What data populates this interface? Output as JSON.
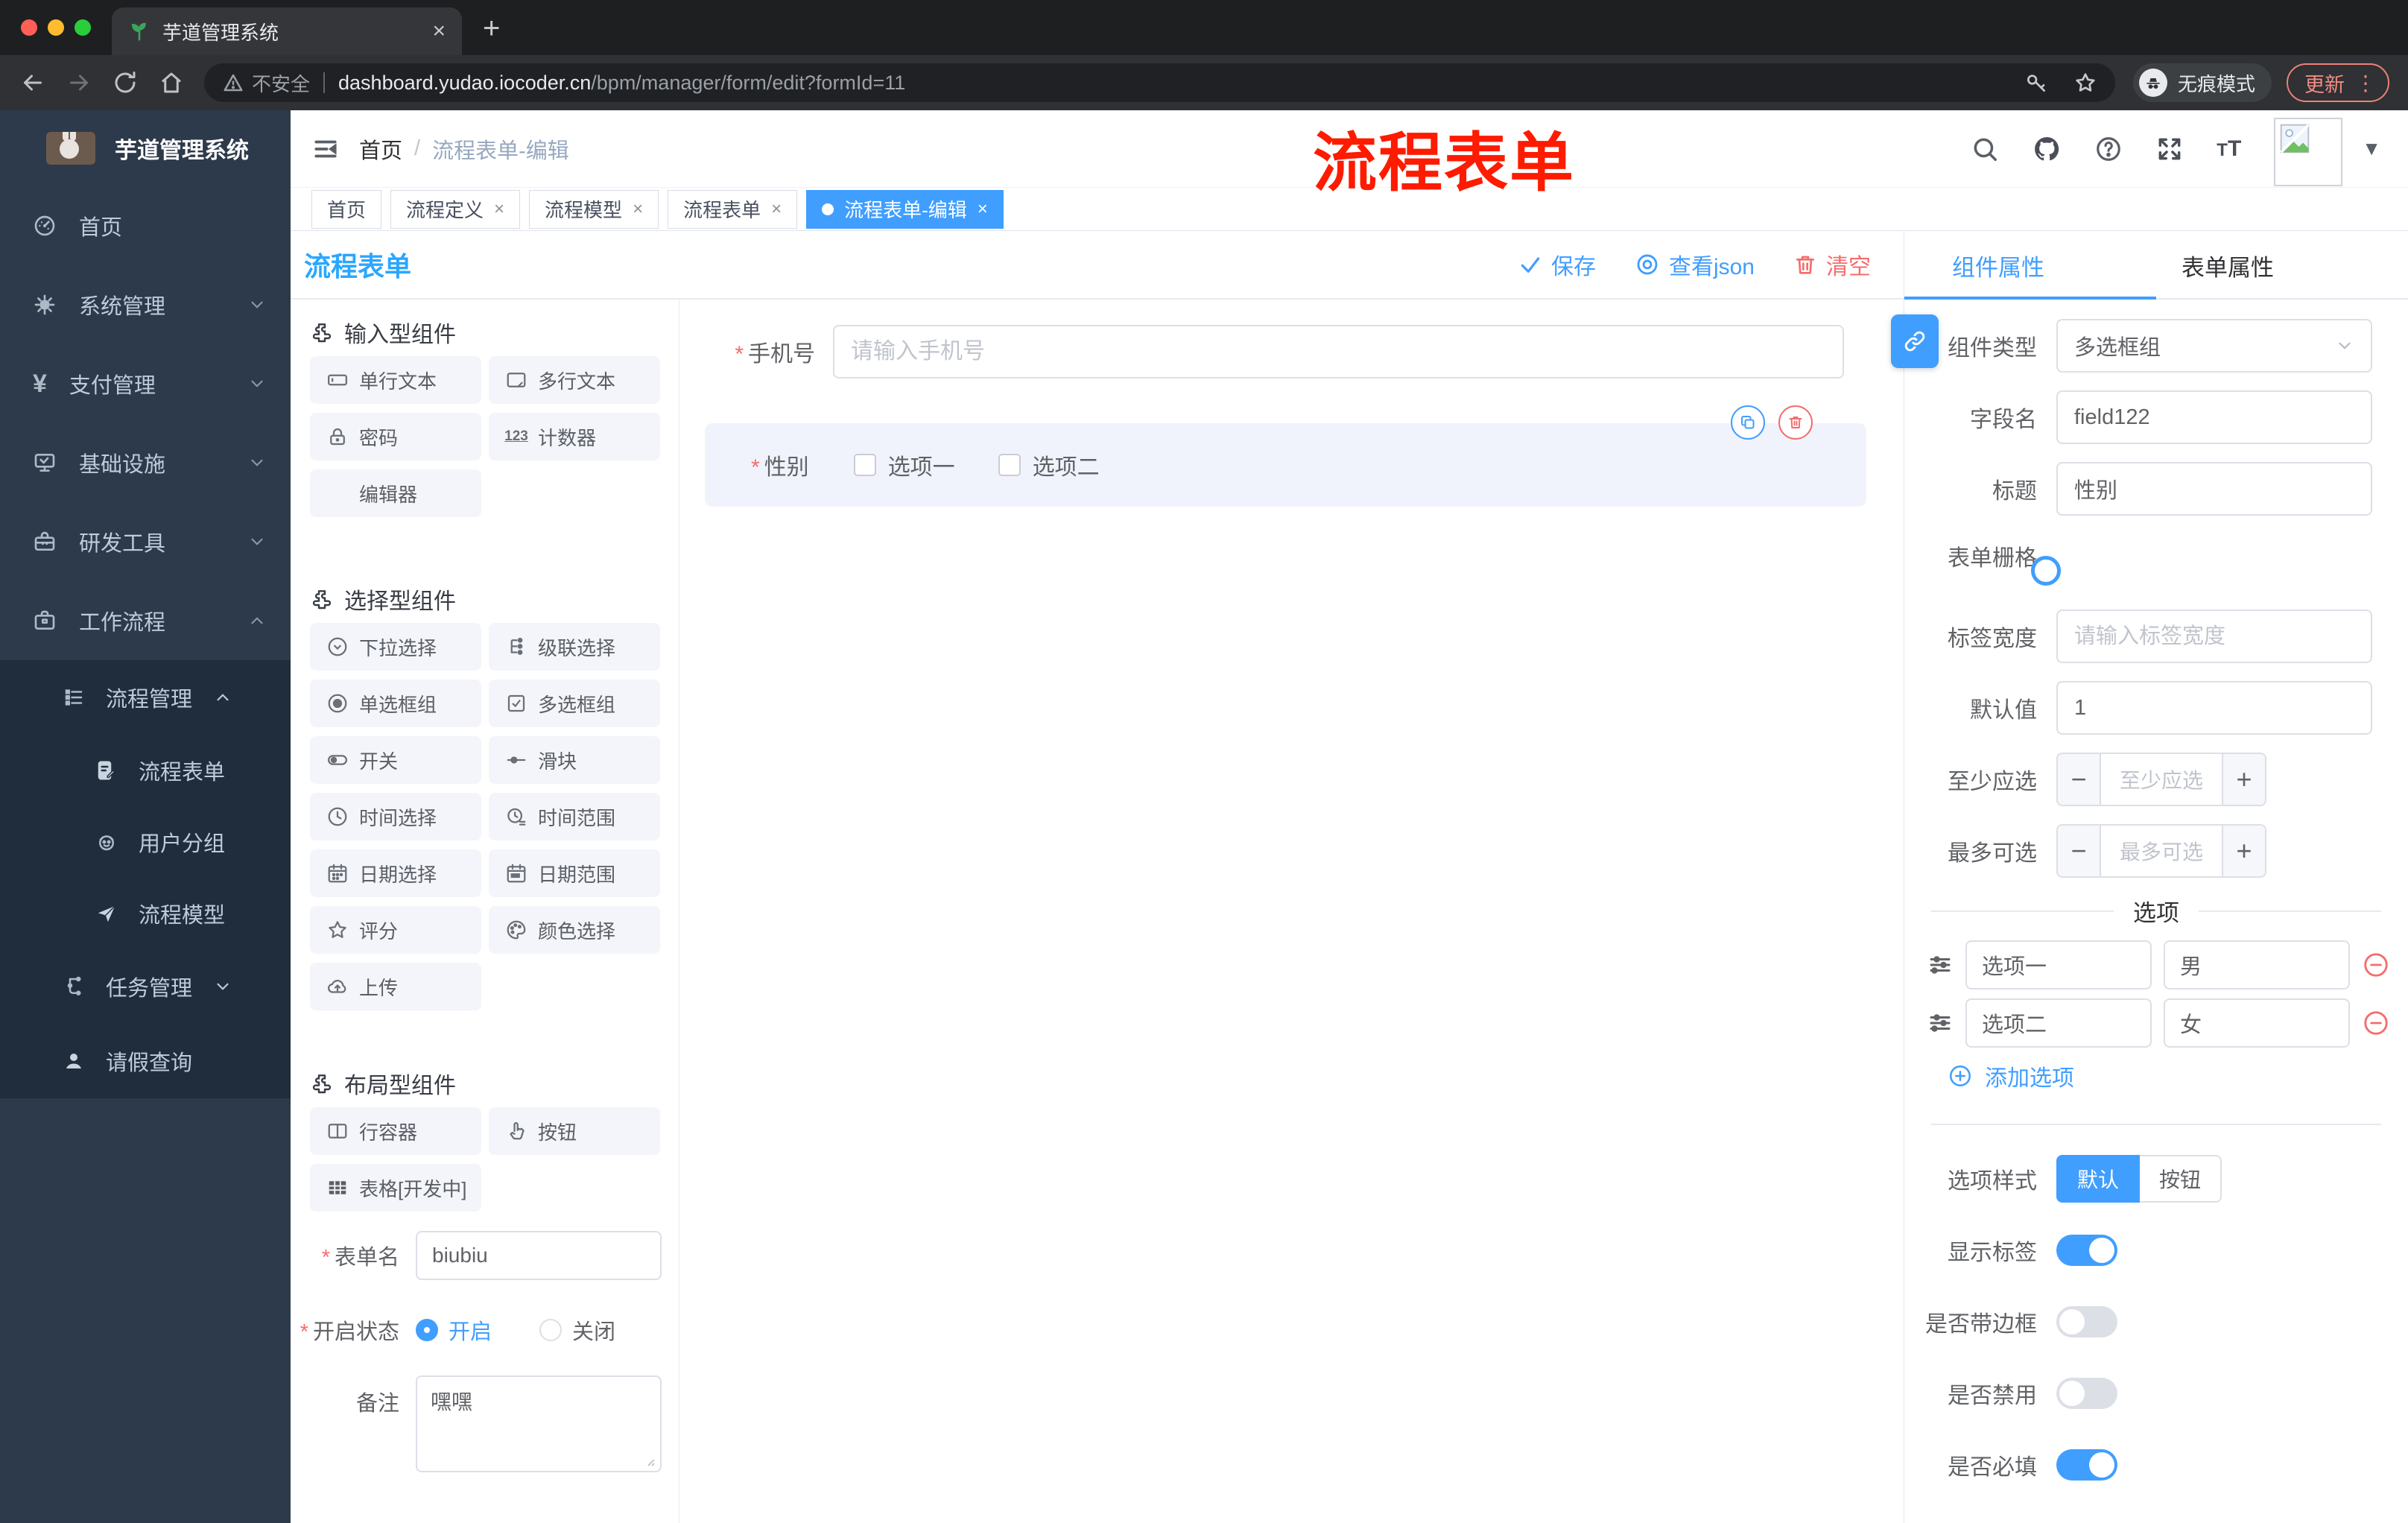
{
  "colors": {
    "accent": "#409EFF",
    "danger": "#F56C6C",
    "annotation_red": "#FE1B00"
  },
  "browser": {
    "tab_title": "芋道管理系统",
    "security_label": "不安全",
    "url_domain": "dashboard.yudao.iocoder.cn",
    "url_path": "/bpm/manager/form/edit?formId=11",
    "incognito_label": "无痕模式",
    "update_label": "更新"
  },
  "sidebar": {
    "logo_title": "芋道管理系统",
    "items": [
      {
        "label": "首页"
      },
      {
        "label": "系统管理"
      },
      {
        "label": "支付管理"
      },
      {
        "label": "基础设施"
      },
      {
        "label": "研发工具"
      },
      {
        "label": "工作流程"
      },
      {
        "label": "流程管理"
      },
      {
        "label": "流程表单"
      },
      {
        "label": "用户分组"
      },
      {
        "label": "流程模型"
      },
      {
        "label": "任务管理"
      },
      {
        "label": "请假查询"
      }
    ]
  },
  "header": {
    "breadcrumb_home": "首页",
    "breadcrumb_sep": "/",
    "breadcrumb_current": "流程表单-编辑",
    "annotation": "流程表单"
  },
  "view_tabs": {
    "tabs": [
      {
        "label": "首页"
      },
      {
        "label": "流程定义"
      },
      {
        "label": "流程模型"
      },
      {
        "label": "流程表单"
      },
      {
        "label": "流程表单-编辑"
      }
    ]
  },
  "designer": {
    "title": "流程表单",
    "save": "保存",
    "view_json": "查看json",
    "clear": "清空"
  },
  "components": {
    "sections": [
      {
        "title": "输入型组件"
      },
      {
        "title": "选择型组件"
      },
      {
        "title": "布局型组件"
      }
    ],
    "items": {
      "single_text": "单行文本",
      "multi_text": "多行文本",
      "password": "密码",
      "counter": "计数器",
      "editor": "编辑器",
      "select": "下拉选择",
      "cascader": "级联选择",
      "radio_group": "单选框组",
      "checkbox_group": "多选框组",
      "switch": "开关",
      "slider": "滑块",
      "time": "时间选择",
      "time_range": "时间范围",
      "date": "日期选择",
      "date_range": "日期范围",
      "rate": "评分",
      "color": "颜色选择",
      "upload": "上传",
      "row_container": "行容器",
      "button": "按钮",
      "table": "表格[开发中]"
    },
    "form": {
      "name_label": "表单名",
      "name_value": "biubiu",
      "status_label": "开启状态",
      "status_on": "开启",
      "status_off": "关闭",
      "remark_label": "备注",
      "remark_value": "嘿嘿"
    }
  },
  "canvas": {
    "phone": {
      "label": "手机号",
      "placeholder": "请输入手机号"
    },
    "gender": {
      "label": "性别",
      "option1": "选项一",
      "option2": "选项二"
    }
  },
  "props": {
    "tab_component": "组件属性",
    "tab_form": "表单属性",
    "component_type_label": "组件类型",
    "component_type_value": "多选框组",
    "field_label": "字段名",
    "field_value": "field122",
    "title_label": "标题",
    "title_value": "性别",
    "grid_label": "表单栅格",
    "label_width_label": "标签宽度",
    "label_width_placeholder": "请输入标签宽度",
    "default_label": "默认值",
    "default_value": "1",
    "min_label": "至少应选",
    "min_placeholder": "至少应选",
    "max_label": "最多可选",
    "max_placeholder": "最多可选",
    "options_title": "选项",
    "option_rows": [
      {
        "name": "选项一",
        "value": "男"
      },
      {
        "name": "选项二",
        "value": "女"
      }
    ],
    "add_option": "添加选项",
    "style_label": "选项样式",
    "style_default": "默认",
    "style_button": "按钮",
    "switch_show_label": "显示标签",
    "switch_border": "是否带边框",
    "switch_disabled": "是否禁用",
    "switch_required": "是否必填"
  }
}
